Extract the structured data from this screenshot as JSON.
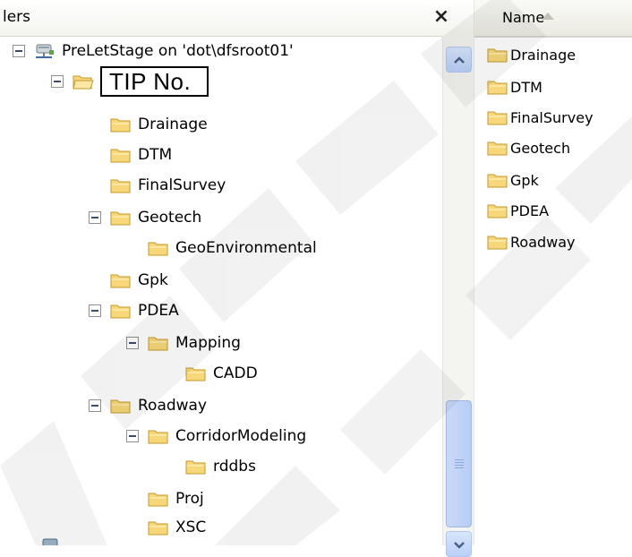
{
  "folders_pane": {
    "title": "lers",
    "close_label": "×"
  },
  "tree": {
    "root_label": "PreLetStage on 'dot\\dfsroot01'",
    "items": [
      {
        "label": "TIP No."
      },
      {
        "label": "Drainage"
      },
      {
        "label": "DTM"
      },
      {
        "label": "FinalSurvey"
      },
      {
        "label": "Geotech"
      },
      {
        "label": "GeoEnvironmental"
      },
      {
        "label": "Gpk"
      },
      {
        "label": "PDEA"
      },
      {
        "label": "Mapping"
      },
      {
        "label": "CADD"
      },
      {
        "label": "Roadway"
      },
      {
        "label": "CorridorModeling"
      },
      {
        "label": "rddbs"
      },
      {
        "label": "Proj"
      },
      {
        "label": "XSC"
      }
    ]
  },
  "list_pane": {
    "column_name": "Name",
    "items": [
      "Drainage",
      "DTM",
      "FinalSurvey",
      "Geotech",
      "Gpk",
      "PDEA",
      "Roadway"
    ]
  },
  "colors": {
    "folder_fill": "#f7d77a",
    "folder_stroke": "#c59a2a",
    "watermark": "#000000"
  }
}
